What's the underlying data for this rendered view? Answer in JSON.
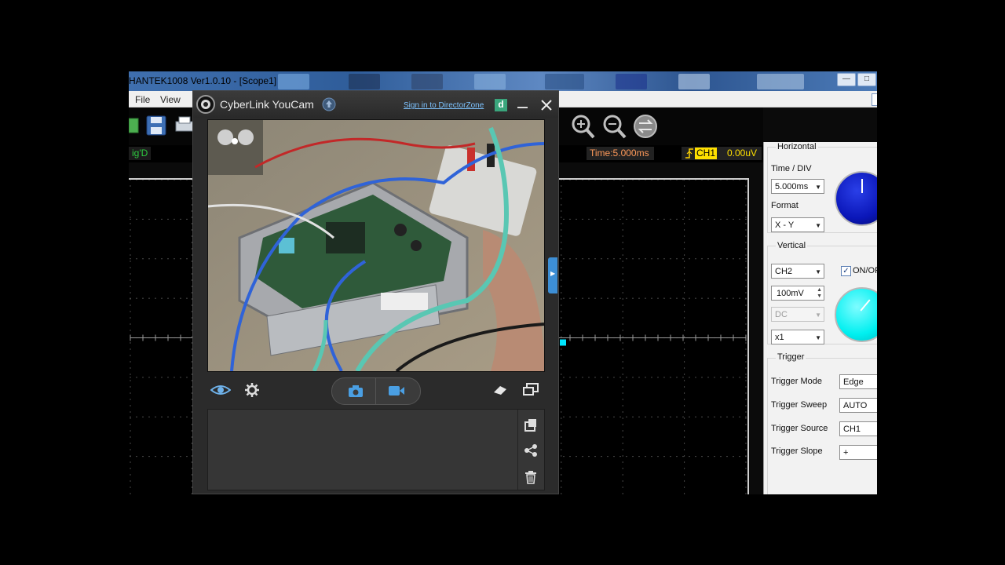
{
  "hantek": {
    "title": "HANTEK1008 Ver1.0.10 - [Scope1]",
    "menu": [
      "File",
      "View"
    ],
    "status": {
      "sig_label": "ig'D",
      "time": "Time:5.000ms",
      "channel": "CH1",
      "voltage": "0.00uV"
    },
    "horizontal": {
      "group": "Horizontal",
      "time_div_label": "Time / DIV",
      "time_div_value": "5.000ms",
      "format_label": "Format",
      "format_value": "X - Y"
    },
    "vertical": {
      "group": "Vertical",
      "channel_value": "CH2",
      "onoff_label": "ON/OF",
      "volts_value": "100mV",
      "coupling_value": "DC",
      "probe_value": "x1"
    },
    "trigger": {
      "group": "Trigger",
      "mode_label": "Trigger Mode",
      "mode_value": "Edge",
      "sweep_label": "Trigger Sweep",
      "sweep_value": "AUTO",
      "source_label": "Trigger Source",
      "source_value": "CH1",
      "slope_label": "Trigger Slope",
      "slope_value": "+"
    },
    "colors": {
      "knob_blue": "#0a16b8",
      "knob_cyan": "#00f0f0",
      "trace": "#00e5ff"
    }
  },
  "youcam": {
    "title": "CyberLink YouCam",
    "sign_in": "Sign in to DirectorZone",
    "director_badge": "d",
    "icons": [
      "eye-icon",
      "gear-icon",
      "camera-icon",
      "video-icon",
      "eraser-icon",
      "fullscreen-icon",
      "export-icon",
      "share-icon",
      "trash-icon"
    ]
  }
}
